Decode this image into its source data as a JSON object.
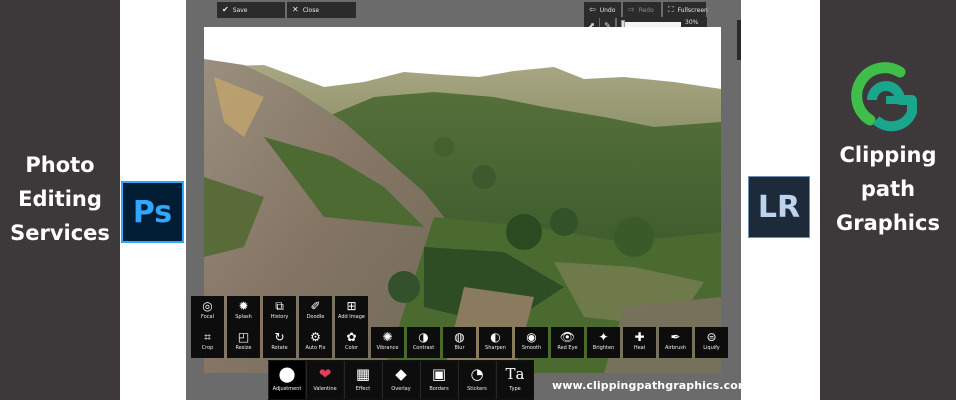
{
  "left_panel": {
    "lines": [
      "Photo",
      "Editing",
      "Services"
    ]
  },
  "right_panel": {
    "lines": [
      "Clipping",
      "path",
      "Graphics"
    ]
  },
  "logos": {
    "ps": "Ps",
    "lr": "LR"
  },
  "colors": {
    "panel_bg": "#3d383a",
    "ps_blue": "#31a8ff",
    "logo_green": "#3fbf4a",
    "logo_teal": "#1aa58d",
    "toolbar_bg": "#0d0d0d"
  },
  "editor": {
    "save_label": "Save",
    "close_label": "Close",
    "undo_label": "Undo",
    "redo_label": "Redo",
    "fullscreen_label": "Fullscreen",
    "zoom_label": "30%",
    "icons": {
      "save": "check-icon",
      "close": "x-icon",
      "undo": "undo-arrow-icon",
      "redo": "redo-arrow-icon",
      "fullscreen": "fullscreen-icon",
      "export": "export-icon",
      "edit": "edit-icon"
    }
  },
  "tools_row1": [
    {
      "label": "Focal",
      "icon": "focal-icon"
    },
    {
      "label": "Splash",
      "icon": "splash-icon"
    },
    {
      "label": "History",
      "icon": "history-icon"
    },
    {
      "label": "Doodle",
      "icon": "doodle-icon"
    },
    {
      "label": "Add Image",
      "icon": "add-image-icon"
    }
  ],
  "tools_row2": [
    {
      "label": "Crop",
      "icon": "crop-icon"
    },
    {
      "label": "Resize",
      "icon": "resize-icon"
    },
    {
      "label": "Rotate",
      "icon": "rotate-icon"
    },
    {
      "label": "Auto Fix",
      "icon": "auto-fix-icon"
    },
    {
      "label": "Color",
      "icon": "color-icon"
    },
    {
      "label": "Vibrance",
      "icon": "vibrance-icon"
    },
    {
      "label": "Contrast",
      "icon": "contrast-icon"
    },
    {
      "label": "Blur",
      "icon": "blur-icon"
    },
    {
      "label": "Sharpen",
      "icon": "sharpen-icon"
    },
    {
      "label": "Smooth",
      "icon": "smooth-icon"
    },
    {
      "label": "Red Eye",
      "icon": "red-eye-icon"
    },
    {
      "label": "Brighten",
      "icon": "brighten-icon"
    },
    {
      "label": "Heal",
      "icon": "heal-icon"
    },
    {
      "label": "Airbrush",
      "icon": "airbrush-icon"
    },
    {
      "label": "Liquify",
      "icon": "liquify-icon"
    }
  ],
  "categories": [
    {
      "label": "Adjustment",
      "icon": "adjustment-icon",
      "active": true
    },
    {
      "label": "Valentine",
      "icon": "valentine-icon",
      "active": false
    },
    {
      "label": "Effect",
      "icon": "effect-icon",
      "active": false
    },
    {
      "label": "Overlay",
      "icon": "overlay-icon",
      "active": false
    },
    {
      "label": "Borders",
      "icon": "borders-icon",
      "active": false
    },
    {
      "label": "Stickers",
      "icon": "stickers-icon",
      "active": false
    },
    {
      "label": "Type",
      "icon": "type-icon",
      "active": false
    }
  ],
  "website": "www.clippingpathgraphics.com"
}
